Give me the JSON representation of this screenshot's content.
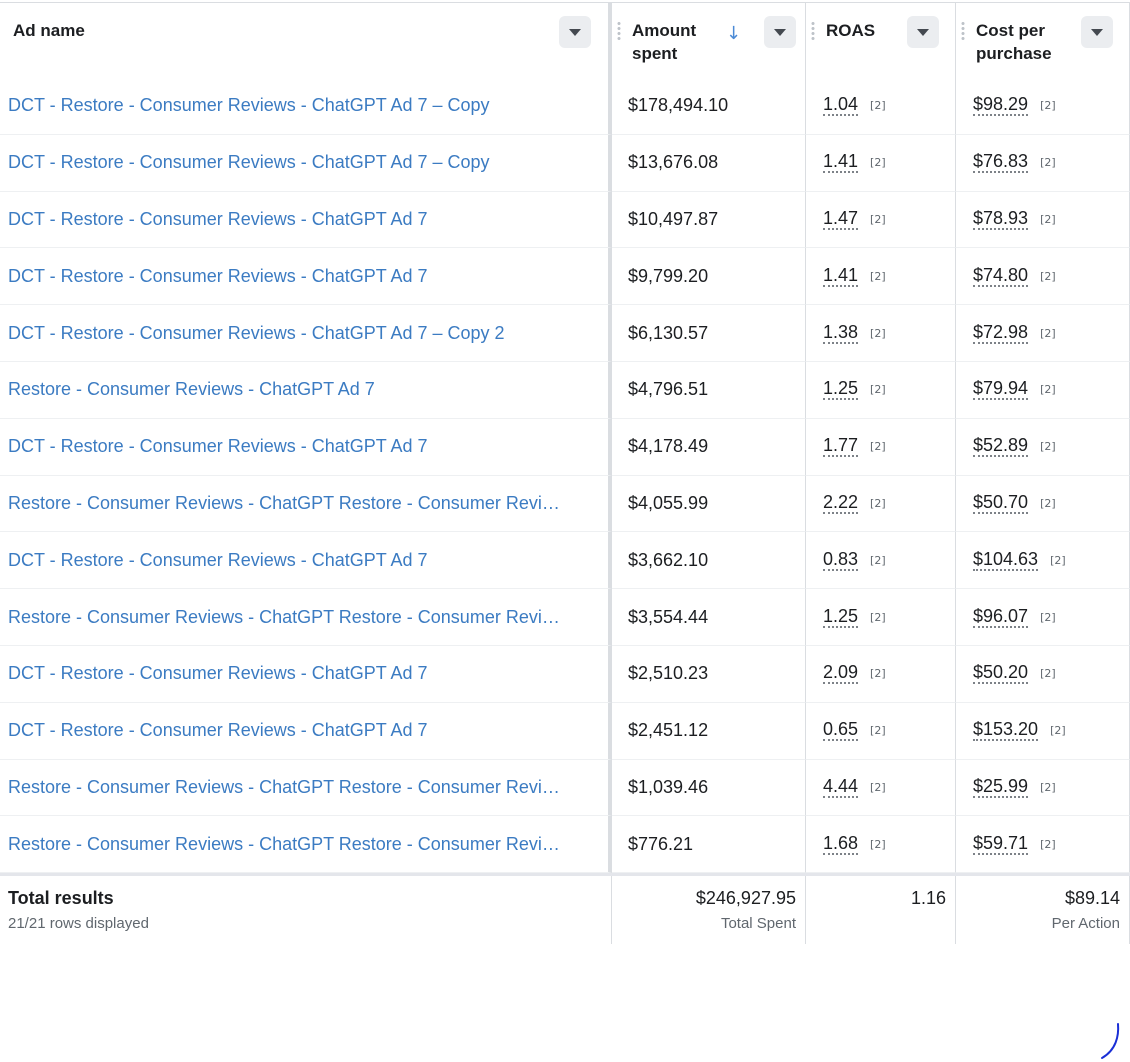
{
  "headers": {
    "ad_name": "Ad name",
    "amount_spent": "Amount spent",
    "roas": "ROAS",
    "cost_per_purchase": "Cost per purchase"
  },
  "rows": [
    {
      "name": "DCT - Restore - Consumer Reviews - ChatGPT Ad 7 – Copy",
      "spent": "$178,494.10",
      "roas": "1.04",
      "roas_note": "[2]",
      "cpp": "$98.29",
      "cpp_note": "[2]"
    },
    {
      "name": "DCT - Restore - Consumer Reviews - ChatGPT Ad 7 – Copy",
      "spent": "$13,676.08",
      "roas": "1.41",
      "roas_note": "[2]",
      "cpp": "$76.83",
      "cpp_note": "[2]"
    },
    {
      "name": "DCT - Restore - Consumer Reviews - ChatGPT Ad 7",
      "spent": "$10,497.87",
      "roas": "1.47",
      "roas_note": "[2]",
      "cpp": "$78.93",
      "cpp_note": "[2]"
    },
    {
      "name": "DCT - Restore - Consumer Reviews - ChatGPT Ad 7",
      "spent": "$9,799.20",
      "roas": "1.41",
      "roas_note": "[2]",
      "cpp": "$74.80",
      "cpp_note": "[2]"
    },
    {
      "name": "DCT - Restore - Consumer Reviews - ChatGPT Ad 7 – Copy 2",
      "spent": "$6,130.57",
      "roas": "1.38",
      "roas_note": "[2]",
      "cpp": "$72.98",
      "cpp_note": "[2]"
    },
    {
      "name": "Restore - Consumer Reviews - ChatGPT Ad 7",
      "spent": "$4,796.51",
      "roas": "1.25",
      "roas_note": "[2]",
      "cpp": "$79.94",
      "cpp_note": "[2]"
    },
    {
      "name": "DCT - Restore - Consumer Reviews - ChatGPT Ad 7",
      "spent": "$4,178.49",
      "roas": "1.77",
      "roas_note": "[2]",
      "cpp": "$52.89",
      "cpp_note": "[2]"
    },
    {
      "name": "Restore - Consumer Reviews - ChatGPT Restore - Consumer Revi…",
      "spent": "$4,055.99",
      "roas": "2.22",
      "roas_note": "[2]",
      "cpp": "$50.70",
      "cpp_note": "[2]"
    },
    {
      "name": "DCT - Restore - Consumer Reviews - ChatGPT Ad 7",
      "spent": "$3,662.10",
      "roas": "0.83",
      "roas_note": "[2]",
      "cpp": "$104.63",
      "cpp_note": "[2]"
    },
    {
      "name": "Restore - Consumer Reviews - ChatGPT Restore - Consumer Revi…",
      "spent": "$3,554.44",
      "roas": "1.25",
      "roas_note": "[2]",
      "cpp": "$96.07",
      "cpp_note": "[2]"
    },
    {
      "name": "DCT - Restore - Consumer Reviews - ChatGPT Ad 7",
      "spent": "$2,510.23",
      "roas": "2.09",
      "roas_note": "[2]",
      "cpp": "$50.20",
      "cpp_note": "[2]"
    },
    {
      "name": "DCT - Restore - Consumer Reviews - ChatGPT Ad 7",
      "spent": "$2,451.12",
      "roas": "0.65",
      "roas_note": "[2]",
      "cpp": "$153.20",
      "cpp_note": "[2]"
    },
    {
      "name": "Restore - Consumer Reviews - ChatGPT Restore - Consumer Revi…",
      "spent": "$1,039.46",
      "roas": "4.44",
      "roas_note": "[2]",
      "cpp": "$25.99",
      "cpp_note": "[2]"
    },
    {
      "name": "Restore - Consumer Reviews - ChatGPT Restore - Consumer Revi…",
      "spent": "$776.21",
      "roas": "1.68",
      "roas_note": "[2]",
      "cpp": "$59.71",
      "cpp_note": "[2]"
    }
  ],
  "totals": {
    "label": "Total results",
    "rows_displayed": "21/21 rows displayed",
    "spent": "$246,927.95",
    "spent_label": "Total Spent",
    "roas": "1.16",
    "cpp": "$89.14",
    "cpp_label": "Per Action"
  },
  "sort": {
    "column": "amount_spent",
    "direction": "descending",
    "icon": "arrow-down-icon"
  },
  "colors": {
    "link": "#3b7bc2",
    "sort_arrow": "#4b8ad6",
    "border": "#dadde1"
  }
}
